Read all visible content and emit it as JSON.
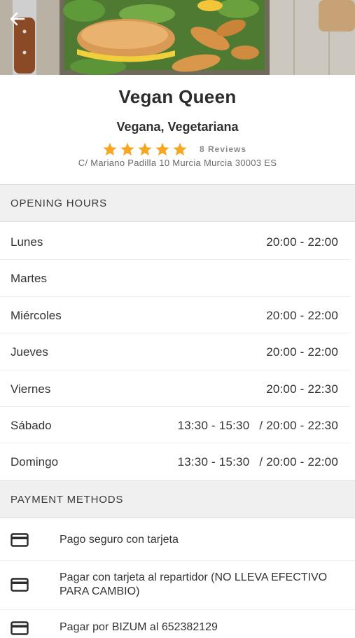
{
  "restaurant": {
    "name": "Vegan Queen",
    "cuisine": "Vegana, Vegetariana",
    "rating": 5,
    "reviews": "8 Reviews",
    "address": "C/ Mariano Padilla 10 Murcia Murcia 30003 ES"
  },
  "opening_hours": {
    "title": "OPENING HOURS",
    "days": [
      {
        "day": "Lunes",
        "hours": "20:00 - 22:00"
      },
      {
        "day": "Martes",
        "hours": ""
      },
      {
        "day": "Miércoles",
        "hours": "20:00 - 22:00"
      },
      {
        "day": "Jueves",
        "hours": "20:00 - 22:00"
      },
      {
        "day": "Viernes",
        "hours": "20:00 - 22:30"
      },
      {
        "day": "Sábado",
        "slot_a": "13:30 - 15:30",
        "slot_b": "/ 20:00 - 22:30"
      },
      {
        "day": "Domingo",
        "slot_a": "13:30 - 15:30",
        "slot_b": "/ 20:00 - 22:00"
      }
    ]
  },
  "payment_methods": {
    "title": "PAYMENT METHODS",
    "items": [
      {
        "label": "Pago seguro con tarjeta",
        "icon": "credit-card-icon"
      },
      {
        "label": "Pagar con tarjeta al repartidor (NO LLEVA EFECTIVO PARA CAMBIO)",
        "icon": "credit-card-icon"
      },
      {
        "label": "Pagar por BIZUM al 652382129",
        "icon": "credit-card-icon"
      }
    ]
  },
  "colors": {
    "star": "#f5a623",
    "section_bg": "#f0f0f0"
  }
}
